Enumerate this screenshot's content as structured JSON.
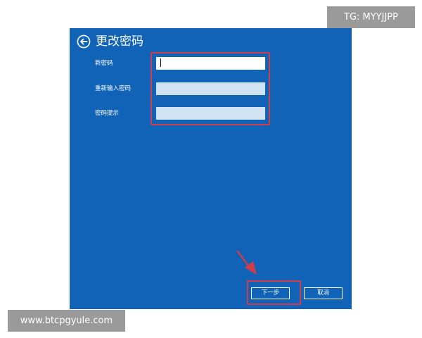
{
  "dialog": {
    "title": "更改密码",
    "fields": [
      {
        "label": "新密码",
        "value": ""
      },
      {
        "label": "重新输入密码",
        "value": ""
      },
      {
        "label": "密码提示",
        "value": ""
      }
    ],
    "next_label": "下一步",
    "cancel_label": "取消"
  },
  "watermarks": {
    "top_right": "TG: MYYJJPP",
    "bottom_left": "www.btcpgyule.com"
  },
  "colors": {
    "panel_bg": "#1063b6",
    "highlight": "#d13b4a",
    "input_active": "#ffffff",
    "input_inactive": "#cfe3f3"
  },
  "icons": {
    "back": "back-arrow-circle-icon",
    "annotation": "red-arrow-icon"
  }
}
